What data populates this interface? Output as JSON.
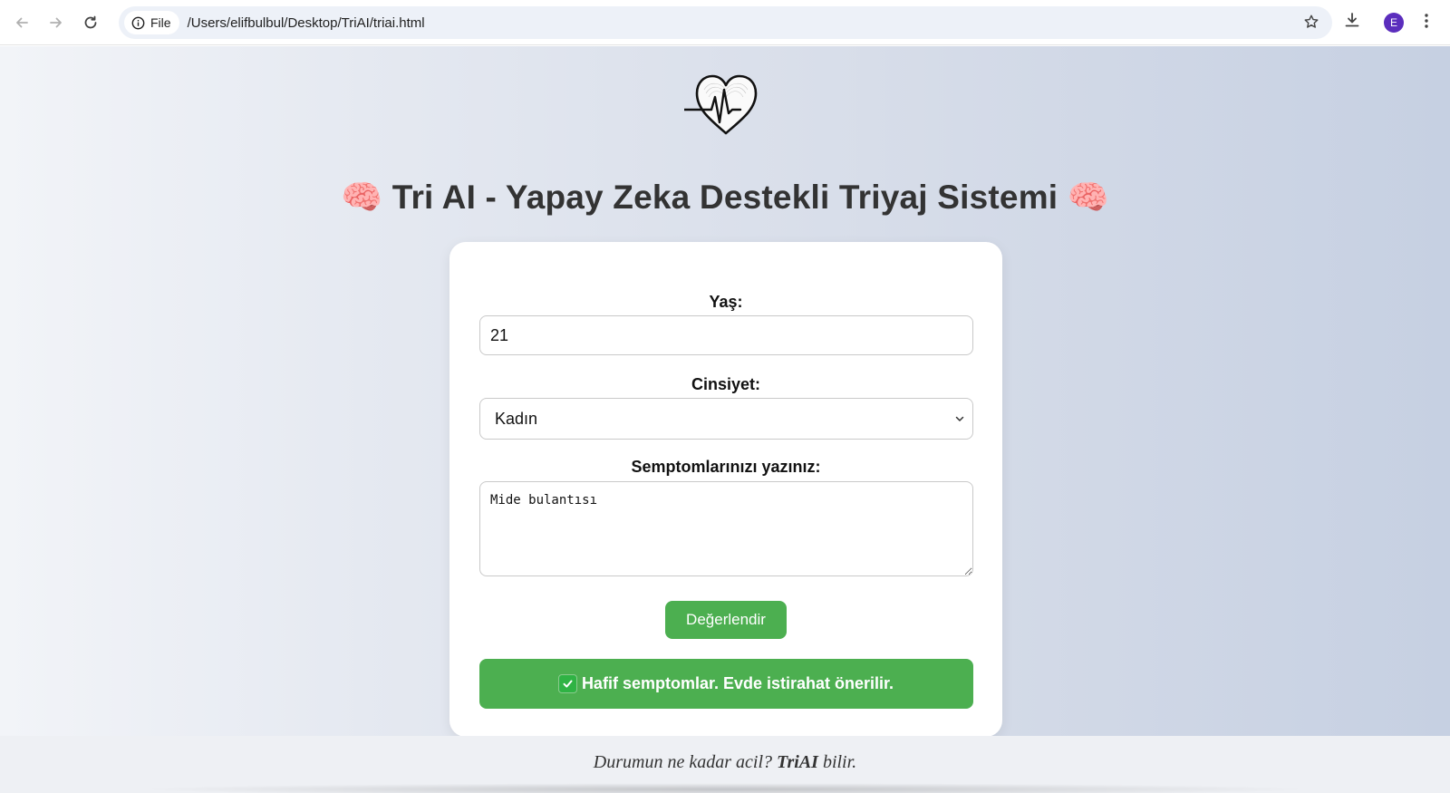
{
  "browser": {
    "file_chip_label": "File",
    "url": "/Users/elifbulbul/Desktop/TriAI/triai.html",
    "avatar_letter": "E",
    "icons": [
      "back-arrow-icon",
      "forward-arrow-icon",
      "reload-icon",
      "info-icon",
      "star-icon",
      "download-icon",
      "kebab-menu-icon"
    ]
  },
  "page": {
    "title": "Tri AI - Yapay Zeka Destekli Triyaj Sistemi",
    "title_icon": "🧠",
    "logo_icon": "heart-pulse-icon"
  },
  "form": {
    "age_label": "Yaş:",
    "age_value": "21",
    "gender_label": "Cinsiyet:",
    "gender_value": "Kadın",
    "symptoms_label": "Semptomlarınızı yazınız:",
    "symptoms_value": "Mide bulantısı",
    "submit_label": "Değerlendir",
    "result_text": "Hafif semptomlar. Evde istirahat önerilir."
  },
  "footer": {
    "text_before": "Durumun ne kadar acil? ",
    "brand": "TriAI",
    "text_after": " bilir."
  },
  "colors": {
    "accent_green": "#4caf50",
    "title_color": "#333333",
    "avatar_purple": "#5b2dbd"
  }
}
